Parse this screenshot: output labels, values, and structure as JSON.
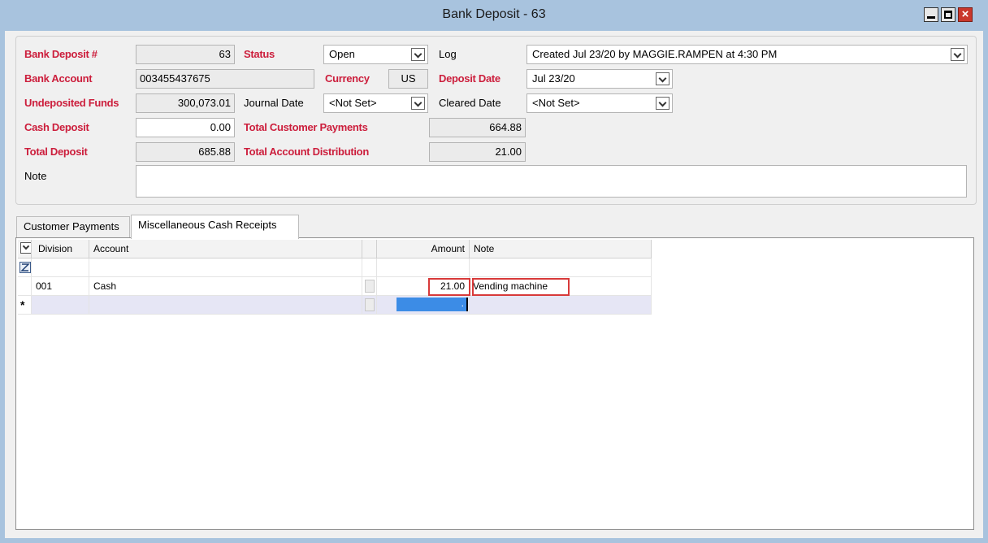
{
  "window": {
    "title": "Bank Deposit - 63",
    "close_glyph": "×"
  },
  "form": {
    "bank_deposit_label": "Bank Deposit #",
    "bank_deposit_value": "63",
    "status_label": "Status",
    "status_value": "Open",
    "log_label": "Log",
    "log_value": "Created Jul 23/20 by MAGGIE.RAMPEN at 4:30 PM",
    "bank_account_label": "Bank Account",
    "bank_account_value": "003455437675",
    "currency_label": "Currency",
    "currency_value": "US",
    "deposit_date_label": "Deposit Date",
    "deposit_date_value": "Jul 23/20",
    "undeposited_label": "Undeposited Funds",
    "undeposited_value": "300,073.01",
    "journal_date_label": "Journal Date",
    "journal_date_value": "<Not Set>",
    "cleared_date_label": "Cleared Date",
    "cleared_date_value": "<Not Set>",
    "cash_deposit_label": "Cash Deposit",
    "cash_deposit_value": "0.00",
    "total_customer_payments_label": "Total Customer Payments",
    "total_customer_payments_value": "664.88",
    "total_deposit_label": "Total Deposit",
    "total_deposit_value": "685.88",
    "total_account_distribution_label": "Total Account Distribution",
    "total_account_distribution_value": "21.00",
    "note_label": "Note",
    "note_value": ""
  },
  "tabs": [
    {
      "label": "Customer Payments",
      "active": false
    },
    {
      "label": "Miscellaneous Cash Receipts",
      "active": true
    }
  ],
  "grid": {
    "columns": [
      "Division",
      "Account",
      "Amount",
      "Note"
    ],
    "filter_icon": "filter-icon",
    "new_row_icon": "new-row-icon",
    "rows": [
      {
        "division": "001",
        "account": "Cash",
        "amount": "21.00",
        "note": "Vending machine"
      }
    ],
    "new_row_amount": "."
  },
  "colors": {
    "required_label": "#cc1e3c",
    "title_bar": "#a8c3de",
    "highlight": "#d83a3a",
    "selection": "#3c8ce6"
  }
}
